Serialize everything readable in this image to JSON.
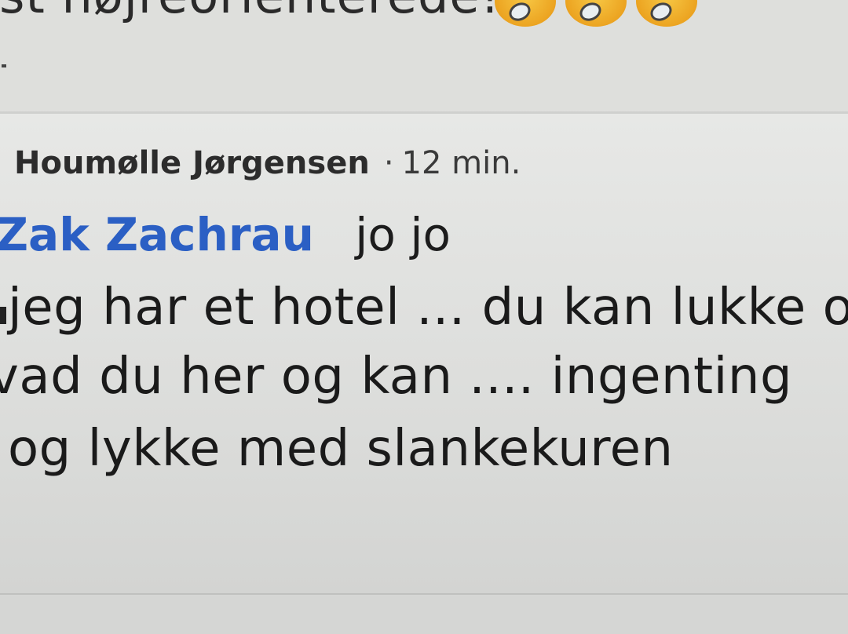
{
  "previous_comment": {
    "text_fragment": "est højreorienterede!",
    "emoji_icons": [
      "grinning-squinting-face-icon",
      "grinning-squinting-face-icon",
      "grinning-squinting-face-icon"
    ]
  },
  "comment": {
    "author": "Houmølle Jørgensen",
    "separator": "·",
    "time": "12 min.",
    "mention": "Zak Zachrau",
    "mention_text": "jo jo",
    "lines": [
      "jeg har et hotel ... du kan lukke o",
      "vad du her  og kan .... ingenting",
      "og lykke med slankekuren"
    ],
    "colors": {
      "mention": "#2b5fc4",
      "text": "#1a1a1a",
      "background": "#e2e3e1"
    }
  },
  "next_comment": {
    "text_fragment": ""
  }
}
